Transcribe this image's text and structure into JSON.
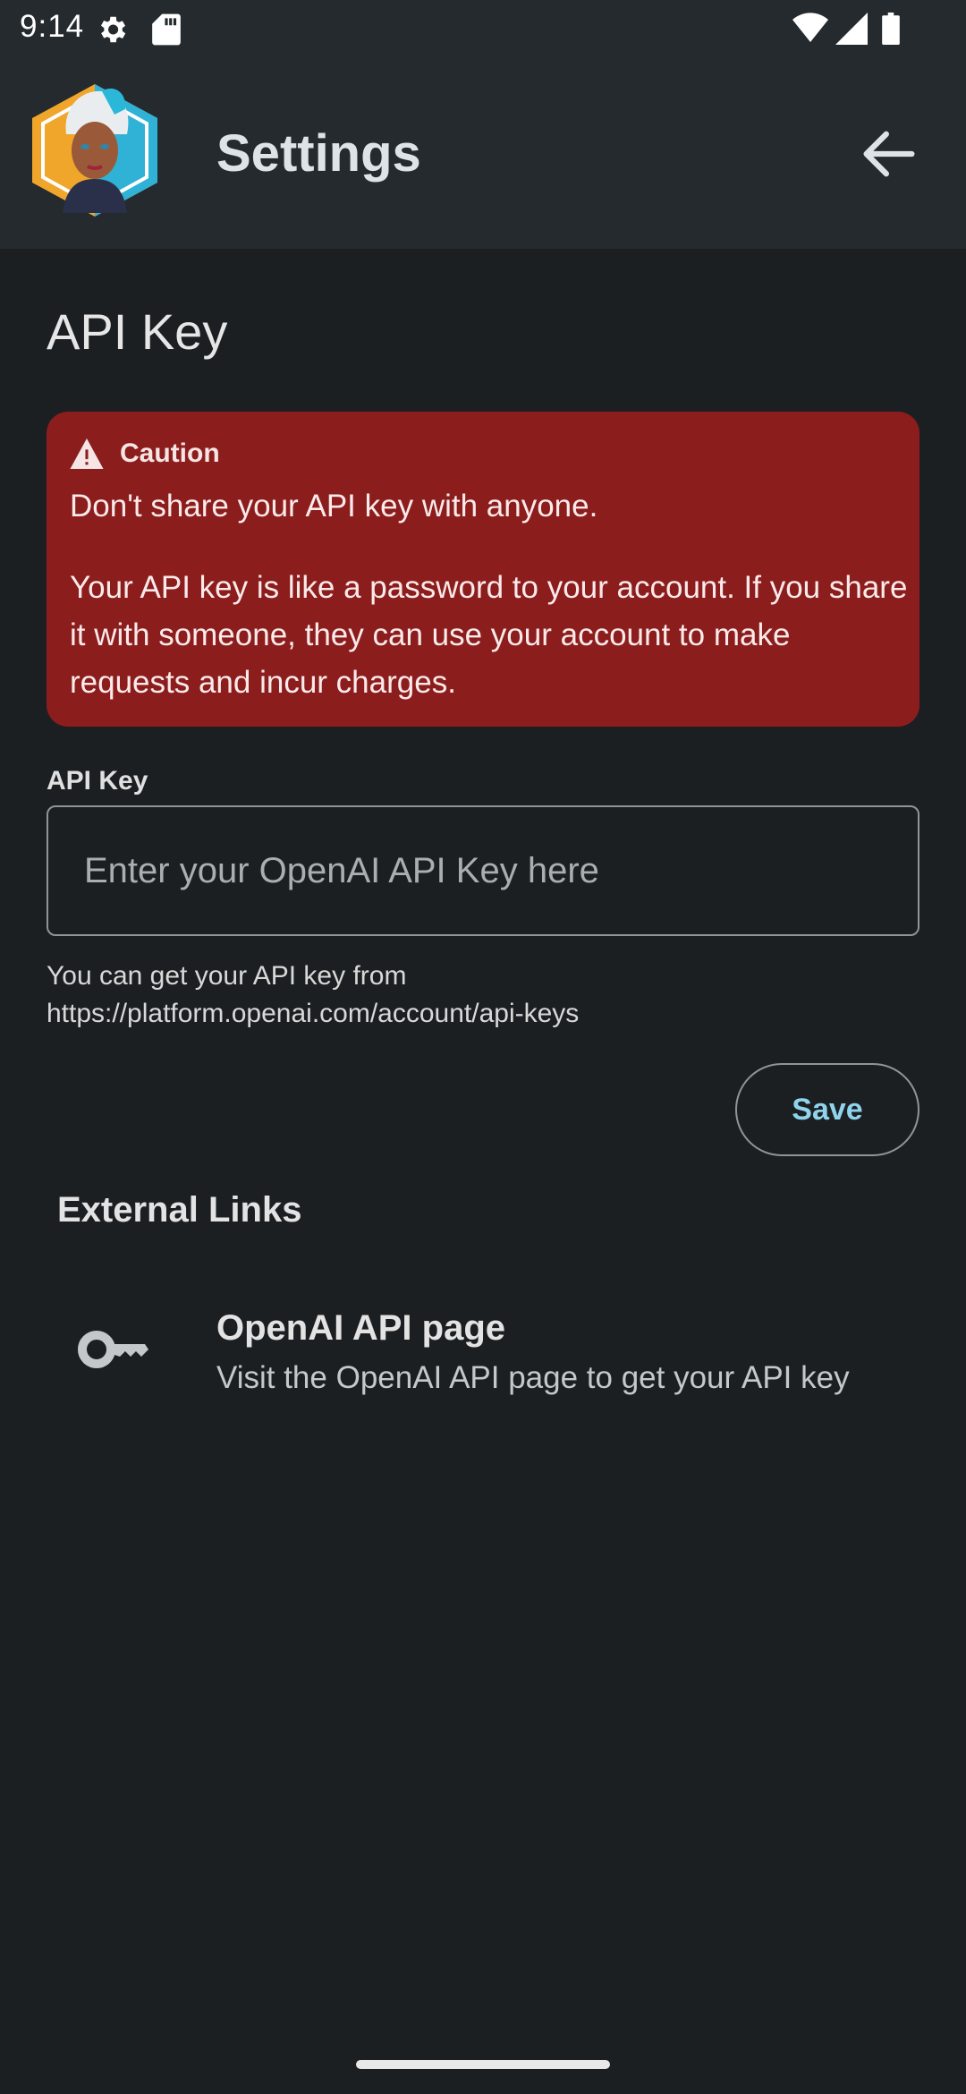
{
  "status_bar": {
    "time": "9:14",
    "icons": [
      "gear-icon",
      "sd-card-icon",
      "wifi-icon",
      "signal-icon",
      "battery-icon"
    ]
  },
  "app_bar": {
    "title": "Settings",
    "avatar": "app-avatar",
    "back_icon": "arrow-back-icon"
  },
  "api_key_section": {
    "title": "API Key",
    "caution": {
      "label": "Caution",
      "line1": "Don't share your API key with anyone.",
      "line2": "Your API key is like a password to your account. If you share it with someone, they can use your account to make requests and incur charges."
    },
    "field_label": "API Key",
    "input_value": "",
    "input_placeholder": "Enter your OpenAI API Key here",
    "helper_line1": "You can get your API key from",
    "helper_line2": "https://platform.openai.com/account/api-keys",
    "save_label": "Save"
  },
  "external_links": {
    "heading": "External Links",
    "items": [
      {
        "icon": "key-icon",
        "title": "OpenAI API page",
        "subtitle": "Visit the OpenAI API page to get your API key"
      }
    ]
  },
  "colors": {
    "background": "#1b1f21",
    "app_bar": "#242a2e",
    "caution_bg": "#8c1d1d",
    "accent": "#8fd3ec"
  }
}
